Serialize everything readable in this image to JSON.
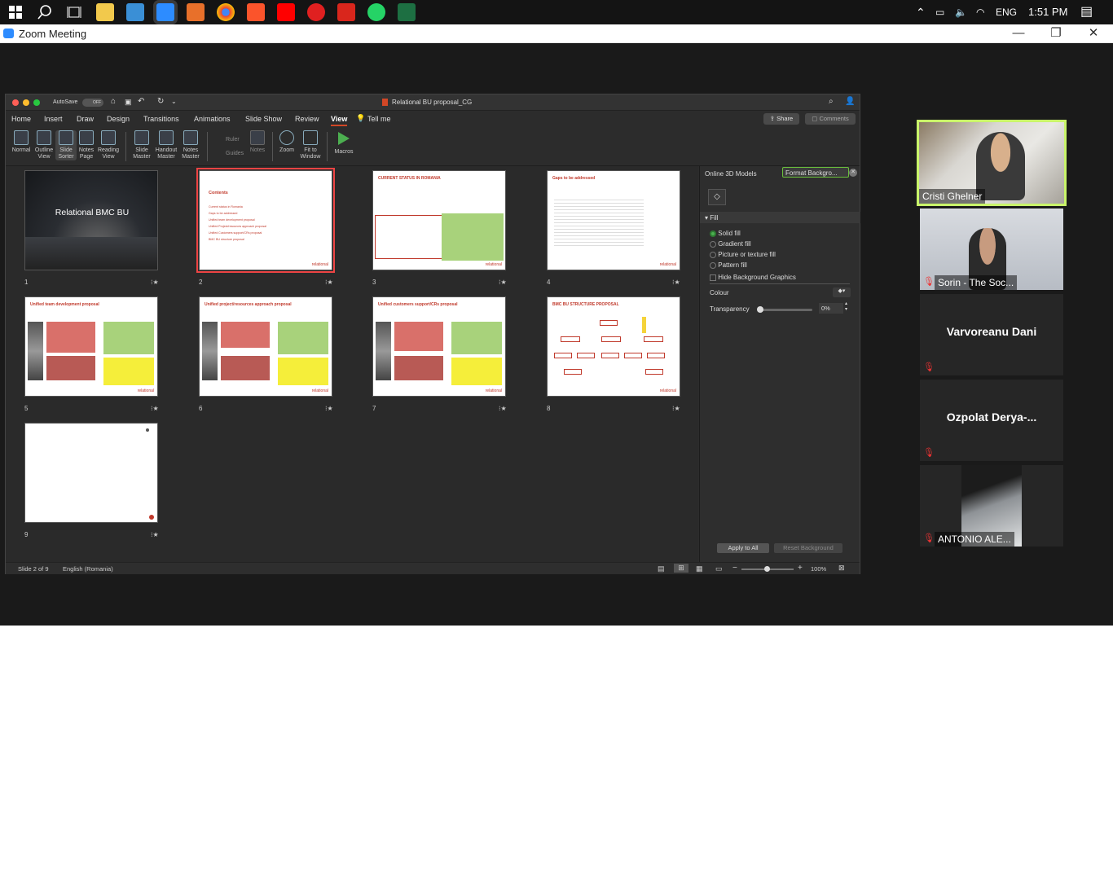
{
  "taskbar": {
    "lang": "ENG",
    "time": "1:51 PM"
  },
  "zoom_window": {
    "title": "Zoom Meeting",
    "minimize": "—",
    "restore": "❐",
    "close": "✕"
  },
  "ppt": {
    "autosave": "AutoSave",
    "autosave_state": "OFF",
    "doc_title": "Relational BU proposal_CG",
    "tabs": [
      "Home",
      "Insert",
      "Draw",
      "Design",
      "Transitions",
      "Animations",
      "Slide Show",
      "Review",
      "View"
    ],
    "tell_me": "Tell me",
    "share": "Share",
    "comments": "Comments",
    "ribbon": {
      "normal": "Normal",
      "outline": "Outline View",
      "slide_sorter": "Slide Sorter",
      "notes_page": "Notes Page",
      "reading_view": "Reading View",
      "slide_master": "Slide Master",
      "handout_master": "Handout Master",
      "notes_master": "Notes Master",
      "ruler": "Ruler",
      "guides": "Guides",
      "notes": "Notes",
      "zoom": "Zoom",
      "fit_window": "Fit to Window",
      "macros": "Macros"
    },
    "slides": [
      {
        "num": "1",
        "title": "Relational BMC BU"
      },
      {
        "num": "2",
        "title": "Contents"
      },
      {
        "num": "3",
        "title": "CURRENT STATUS IN ROMANIA"
      },
      {
        "num": "4",
        "title": "Gaps to be addressed"
      },
      {
        "num": "5",
        "title": "Unified team development proposal"
      },
      {
        "num": "6",
        "title": "Unified project/resources approach proposal"
      },
      {
        "num": "7",
        "title": "Unified customers support/CRs proposal"
      },
      {
        "num": "8",
        "title": "BMC BU STRUCTURE PROPOSAL"
      },
      {
        "num": "9",
        "title": ""
      }
    ],
    "contents_items": [
      "Current status in Romania",
      "Gaps to be addressed",
      "Unified team development proposal",
      "Unified Project/resources approach proposal",
      "Unified Customers support/CRs proposal",
      "BMC BU structure proposal"
    ],
    "logo_text": "relational",
    "panel": {
      "tab1": "Online 3D Models",
      "tab2": "Format Backgro...",
      "section": "Fill",
      "options": [
        "Solid fill",
        "Gradient fill",
        "Picture or texture fill",
        "Pattern fill"
      ],
      "hide_bg": "Hide Background Graphics",
      "colour": "Colour",
      "transparency": "Transparency",
      "transparency_value": "0%",
      "apply_all": "Apply to All",
      "reset_bg": "Reset Background"
    },
    "status": {
      "slide_info": "Slide 2 of 9",
      "language": "English (Romania)",
      "zoom": "100%"
    }
  },
  "participants": [
    {
      "name": "Cristi Ghelner",
      "type": "video"
    },
    {
      "name": "Sorin - The Soc...",
      "type": "video"
    },
    {
      "name": "Varvoreanu Dani",
      "type": "name"
    },
    {
      "name": "Ozpolat  Derya-...",
      "type": "name"
    },
    {
      "name": "ANTONIO ALE...",
      "type": "video"
    }
  ]
}
